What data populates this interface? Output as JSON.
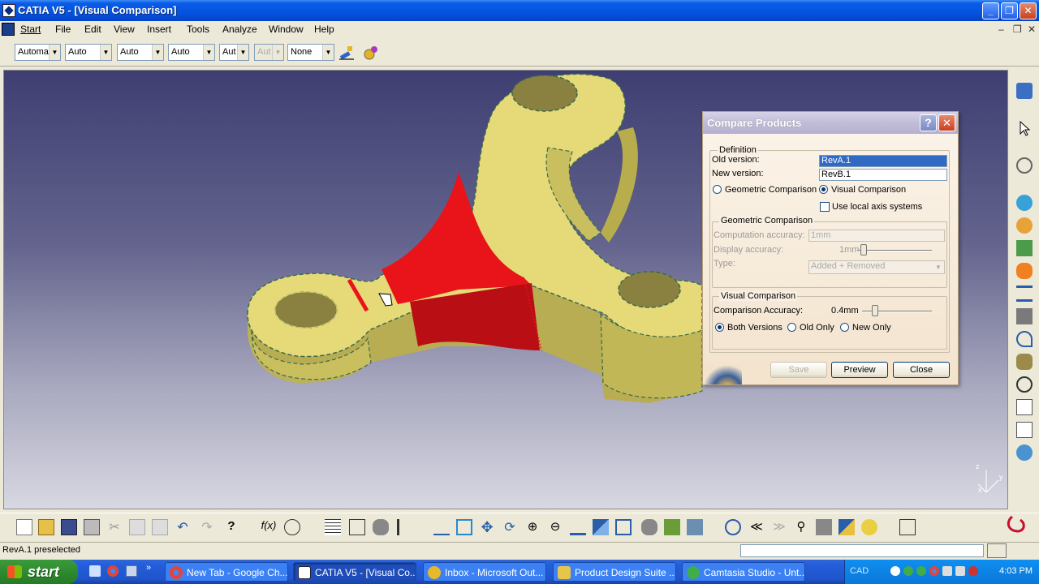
{
  "window": {
    "title": "CATIA V5 - [Visual Comparison]"
  },
  "menu": [
    "Start",
    "File",
    "Edit",
    "View",
    "Insert",
    "Tools",
    "Analyze",
    "Window",
    "Help"
  ],
  "toolbar_combos": [
    {
      "value": "Automa",
      "disabled": false
    },
    {
      "value": "Auto",
      "disabled": false
    },
    {
      "value": "Auto",
      "disabled": false
    },
    {
      "value": "Auto",
      "disabled": false
    },
    {
      "value": "Aut",
      "disabled": false
    },
    {
      "value": "Aut",
      "disabled": true
    },
    {
      "value": "None",
      "disabled": false
    }
  ],
  "dialog": {
    "title": "Compare Products",
    "help": "?",
    "definition_label": "Definition",
    "old_version_label": "Old version:",
    "old_version_value": "RevA.1",
    "new_version_label": "New version:",
    "new_version_value": "RevB.1",
    "mode_geometric": "Geometric Comparison",
    "mode_visual": "Visual Comparison",
    "use_local_axis": "Use local axis systems",
    "geo_group": "Geometric Comparison",
    "computation_accuracy_label": "Computation accuracy:",
    "computation_accuracy_value": "1mm",
    "display_accuracy_label": "Display accuracy:",
    "display_accuracy_value": "1mm",
    "type_label": "Type:",
    "type_value": "Added + Removed",
    "visual_group": "Visual Comparison",
    "comparison_accuracy_label": "Comparison Accuracy:",
    "comparison_accuracy_value": "0.4mm",
    "both_versions": "Both Versions",
    "old_only": "Old Only",
    "new_only": "New Only",
    "save": "Save",
    "preview": "Preview",
    "close": "Close"
  },
  "status": {
    "text": "RevA.1 preselected"
  },
  "taskbar": {
    "start": "start",
    "tasks": [
      "New Tab - Google Ch...",
      "CATIA V5 - [Visual Co...",
      "Inbox - Microsoft Out...",
      "Product Design Suite ...",
      "Camtasia Studio - Unt..."
    ],
    "lang": "CAD",
    "clock": "4:03 PM"
  },
  "colors": {
    "part": "#e6da78",
    "added_removed": "#e8141a",
    "viewport_top": "#3e3e72"
  },
  "axis": {
    "x": "x",
    "y": "y",
    "z": "z"
  }
}
